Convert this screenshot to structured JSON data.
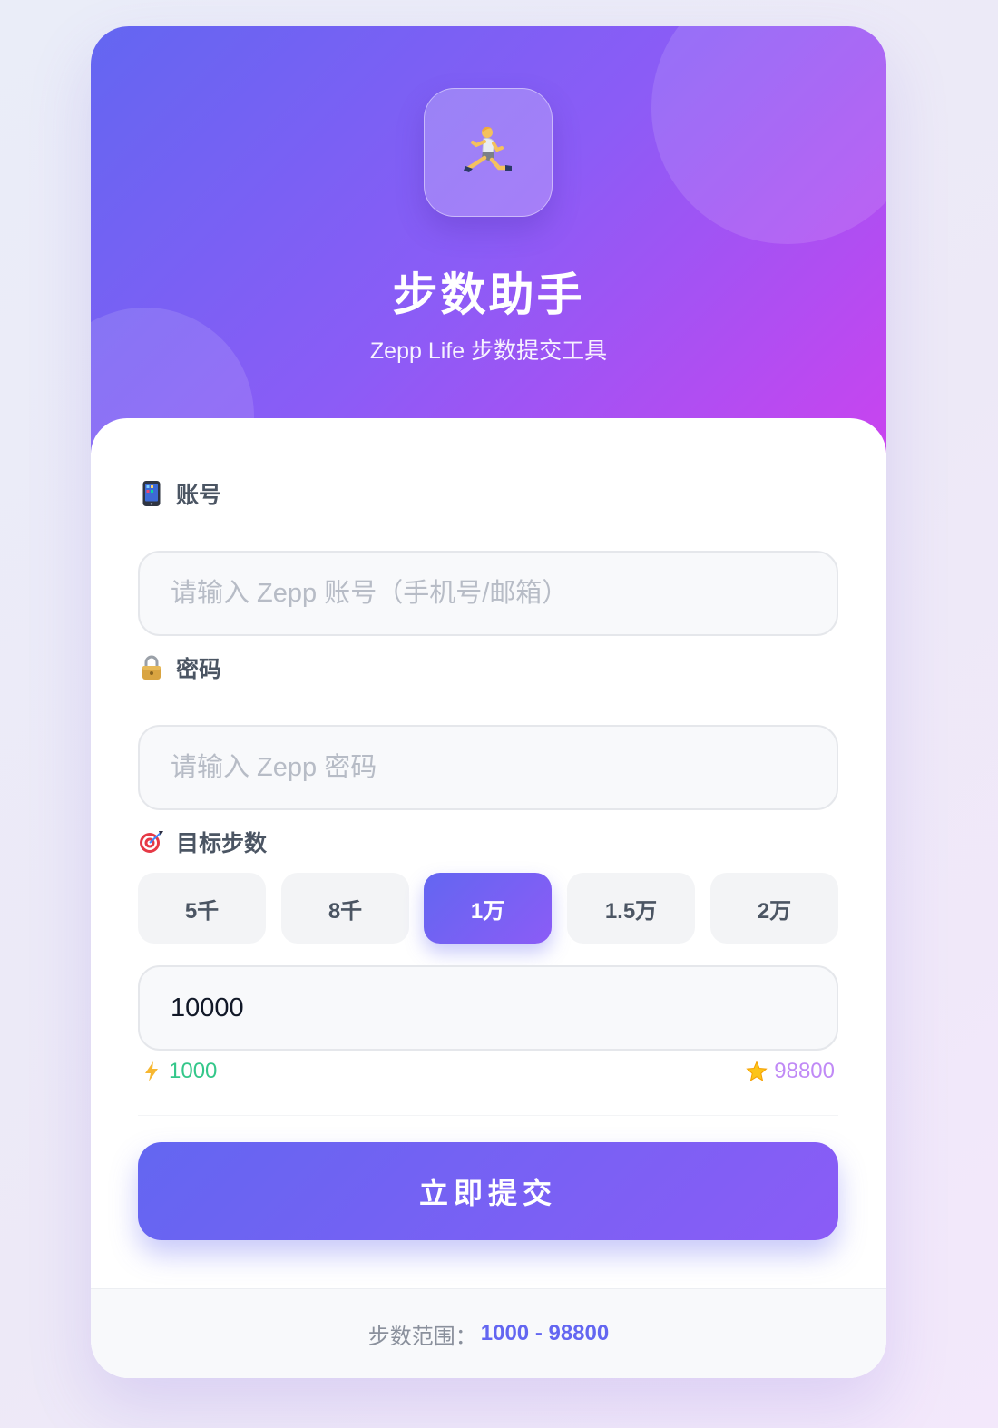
{
  "header": {
    "app_icon": "running-person-icon",
    "title": "步数助手",
    "subtitle": "Zepp Life 步数提交工具",
    "gradient_colors": [
      "#6366f1",
      "#8b5cf6",
      "#c944ef"
    ]
  },
  "account": {
    "label": "账号",
    "icon": "mobile-phone-icon",
    "value": "",
    "placeholder": "请输入 Zepp 账号（手机号/邮箱）"
  },
  "password": {
    "label": "密码",
    "icon": "lock-icon",
    "value": "",
    "placeholder": "请输入 Zepp 密码"
  },
  "steps": {
    "label": "目标步数",
    "icon": "target-icon",
    "presets": [
      {
        "label": "5千",
        "selected": false
      },
      {
        "label": "8千",
        "selected": false
      },
      {
        "label": "1万",
        "selected": true
      },
      {
        "label": "1.5万",
        "selected": false
      },
      {
        "label": "2万",
        "selected": false
      }
    ],
    "value": "10000",
    "min_label": "1000",
    "max_label": "98800",
    "min_icon": "lightning-icon",
    "max_icon": "star-icon"
  },
  "submit": {
    "label": "立即提交"
  },
  "footer": {
    "range_label": "步数范围：",
    "range_value": "1000 - 98800"
  },
  "colors": {
    "accent": "#6366f1",
    "accent_secondary": "#8b5cf6",
    "min_hint": "#34c78a",
    "max_hint": "#c08af6"
  }
}
